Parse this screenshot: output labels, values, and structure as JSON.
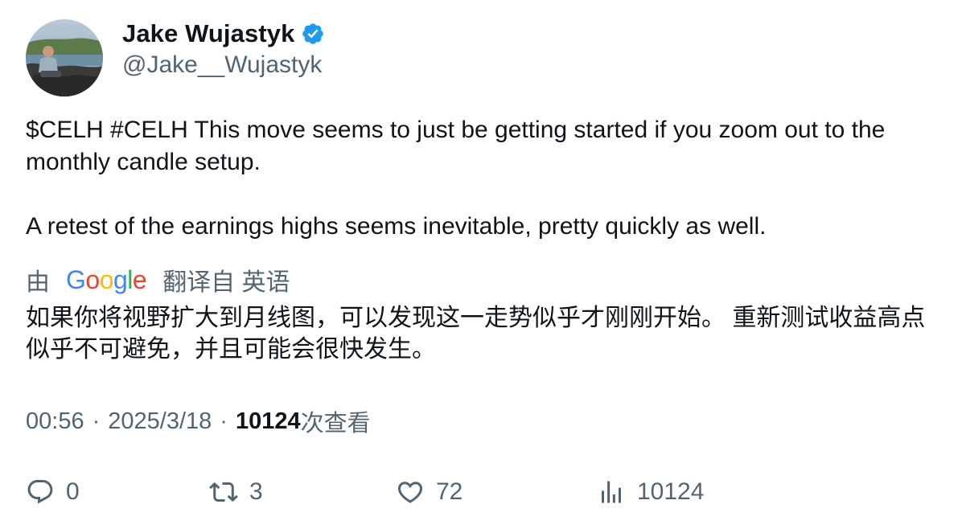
{
  "author": {
    "display_name": "Jake Wujastyk",
    "handle": "@Jake__Wujastyk",
    "verified": true
  },
  "tweet": {
    "text": "$CELH #CELH This move seems to just be getting started if you zoom out to the monthly candle setup.\n\nA retest of the earnings highs seems inevitable, pretty quickly as well."
  },
  "translation": {
    "by_label": "由",
    "provider": "Google",
    "from_label": "翻译自 英语",
    "text": "如果你将视野扩大到月线图，可以发现这一走势似乎才刚刚开始。 重新测试收益高点似乎不可避免，并且可能会很快发生。"
  },
  "meta": {
    "time": "00:56",
    "separator": "·",
    "date": "2025/3/18",
    "views_count": "10124",
    "views_label": "次查看"
  },
  "actions": {
    "reply_count": "0",
    "retweet_count": "3",
    "like_count": "72",
    "views_count": "10124"
  },
  "colors": {
    "text_primary": "#0f1419",
    "text_secondary": "#536471",
    "verified_blue": "#1d9bf0",
    "google_blue": "#4285F4",
    "google_red": "#EA4335",
    "google_yellow": "#FBBC05",
    "google_green": "#34A853"
  },
  "icons": {
    "verified": "verified-badge-icon",
    "reply": "reply-bubble-icon",
    "retweet": "retweet-arrows-icon",
    "like": "heart-icon",
    "views": "analytics-bars-icon"
  }
}
